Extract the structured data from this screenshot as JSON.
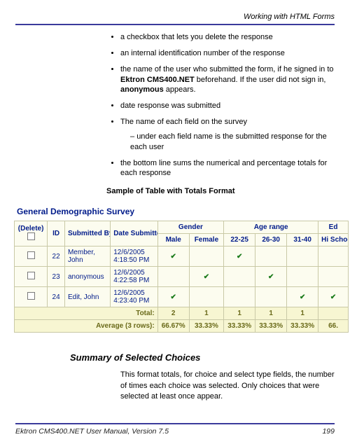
{
  "header": {
    "title": "Working with HTML Forms"
  },
  "bullets": [
    "a checkbox that lets you delete the response",
    "an internal identification number of the response",
    "the name of the user who submitted the form, if he signed in to Ektron CMS400.NET beforehand. If the user did not sign in, anonymous appears.",
    "date response was submitted",
    "The name of each field on the survey",
    "the bottom line sums the numerical and percentage totals for each response"
  ],
  "bullet_bold": {
    "product": "Ektron CMS400.NET",
    "anon": "anonymous"
  },
  "sub_bullets": [
    "under each field name is the submitted response for the each user"
  ],
  "sample_heading": "Sample of Table with Totals Format",
  "survey": {
    "title": "General Demographic Survey",
    "columns": {
      "delete": "(Delete)",
      "id": "ID",
      "submitted_by": "Submitted By",
      "date_submitted": "Date Submitted",
      "gender": "Gender",
      "age_range": "Age range",
      "ed": "Ed",
      "gender_sub": [
        "Male",
        "Female"
      ],
      "age_sub": [
        "22-25",
        "26-30",
        "31-40"
      ],
      "ed_sub": "Hi Schoo"
    },
    "rows": [
      {
        "id": "22",
        "by": "Member, John",
        "date": "12/6/2005 4:18:50 PM",
        "male": "✔",
        "female": "",
        "a1": "✔",
        "a2": "",
        "a3": "",
        "ed": ""
      },
      {
        "id": "23",
        "by": "anonymous",
        "date": "12/6/2005 4:22:58 PM",
        "male": "",
        "female": "✔",
        "a1": "",
        "a2": "✔",
        "a3": "",
        "ed": ""
      },
      {
        "id": "24",
        "by": "Edit, John",
        "date": "12/6/2005 4:23:40 PM",
        "male": "✔",
        "female": "",
        "a1": "",
        "a2": "",
        "a3": "✔",
        "ed": "✔"
      }
    ],
    "total_label": "Total:",
    "totals": [
      "2",
      "1",
      "1",
      "1",
      "1",
      ""
    ],
    "avg_label": "Average (3 rows):",
    "averages": [
      "66.67%",
      "33.33%",
      "33.33%",
      "33.33%",
      "33.33%",
      "66."
    ]
  },
  "section": {
    "heading": "Summary of Selected Choices",
    "body": "This format totals, for choice and select type fields, the number of times each choice was selected. Only choices that were selected at least once appear."
  },
  "footer": {
    "left": "Ektron CMS400.NET User Manual, Version 7.5",
    "right": "199"
  },
  "chart_data": {
    "type": "table",
    "title": "General Demographic Survey — totals & averages",
    "categories": [
      "Male",
      "Female",
      "22-25",
      "26-30",
      "31-40"
    ],
    "series": [
      {
        "name": "Total",
        "values": [
          2,
          1,
          1,
          1,
          1
        ]
      },
      {
        "name": "Average (3 rows) %",
        "values": [
          66.67,
          33.33,
          33.33,
          33.33,
          33.33
        ]
      }
    ]
  }
}
